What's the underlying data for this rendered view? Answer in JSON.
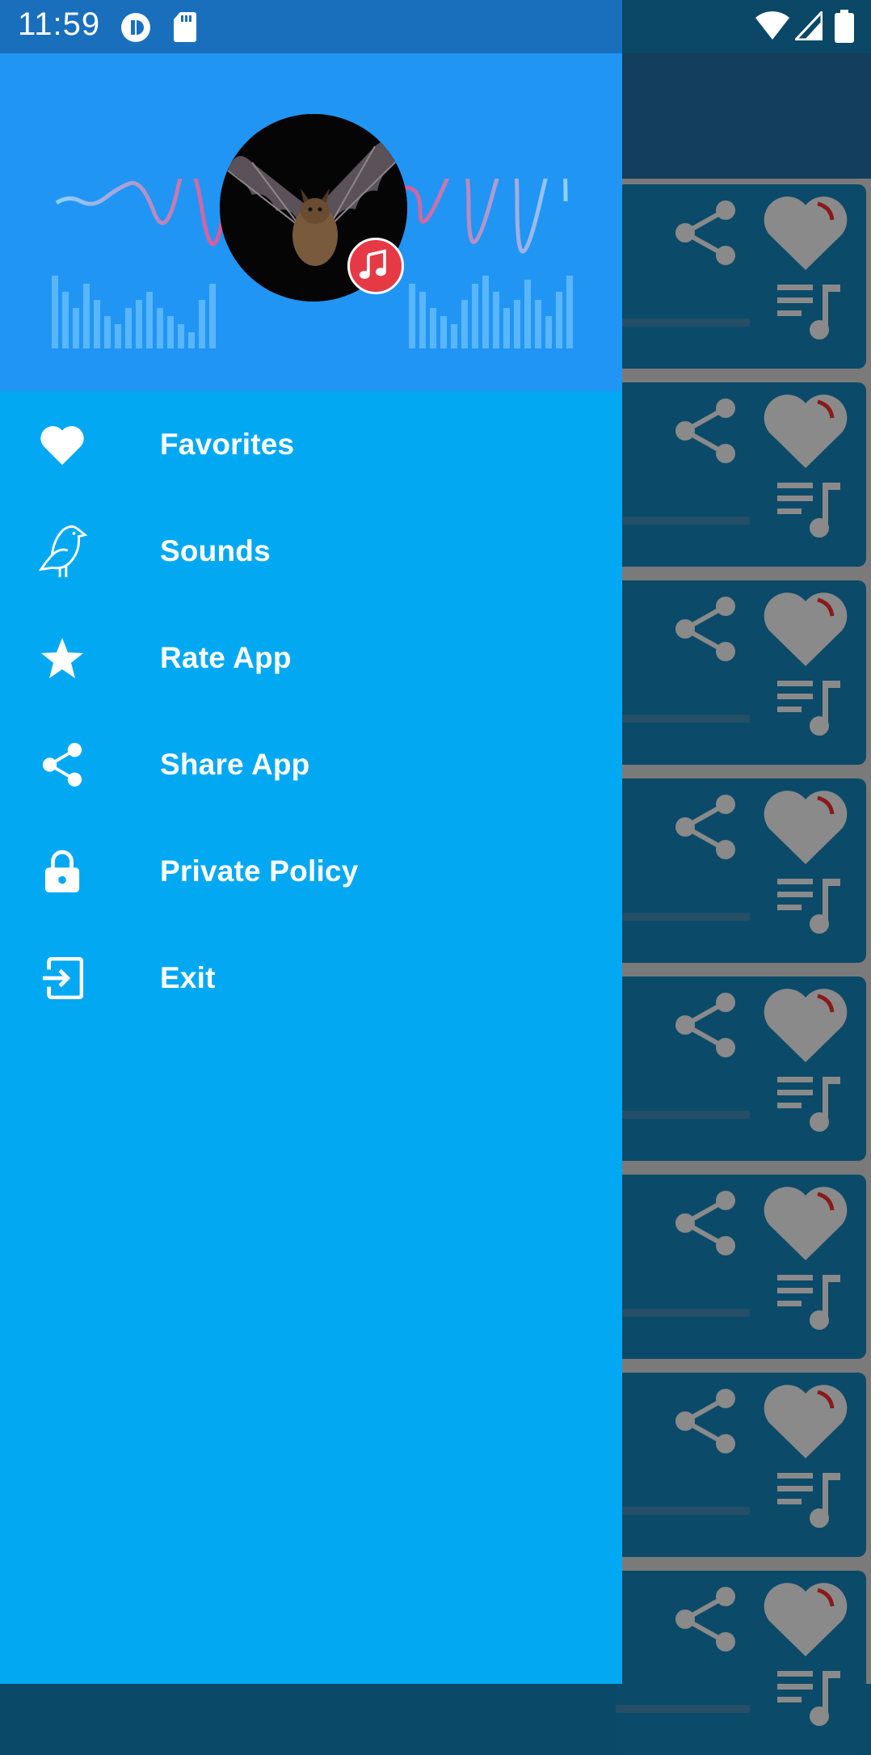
{
  "status_bar": {
    "time": "11:59",
    "icons": [
      "app-notification-icon",
      "sd-card-icon",
      "wifi-icon",
      "signal-icon",
      "battery-icon"
    ]
  },
  "drawer": {
    "header": {
      "avatar_subject": "bat-avatar",
      "badge_icon": "music-note-icon"
    },
    "menu": [
      {
        "label": "Favorites",
        "icon": "heart-icon"
      },
      {
        "label": "Sounds",
        "icon": "bird-icon"
      },
      {
        "label": "Rate App",
        "icon": "star-icon"
      },
      {
        "label": "Share App",
        "icon": "share-icon"
      },
      {
        "label": "Private Policy",
        "icon": "lock-icon"
      },
      {
        "label": "Exit",
        "icon": "exit-icon"
      }
    ]
  },
  "background_list": {
    "card_count": 8,
    "card_icons": [
      "share-icon",
      "favorite-heart-icon",
      "playlist-icon"
    ]
  },
  "colors": {
    "drawer": "#03a8f3",
    "header": "#2195f3",
    "status_bar": "#1a6fbd",
    "badge": "#e63946",
    "overlay_card": "#0c4a69"
  }
}
